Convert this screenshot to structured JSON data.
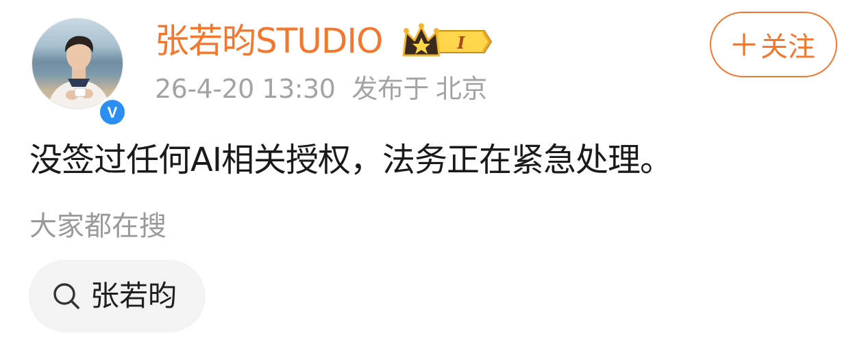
{
  "account": {
    "name": "张若昀STUDIO",
    "verified_badge_letter": "V",
    "member_badge_icon": "crown-icon",
    "member_level": "I",
    "avatar_icon": "avatar-photo"
  },
  "meta": {
    "date": "26-4-20 13:30",
    "posted_from_label": "发布于",
    "location": "北京"
  },
  "follow": {
    "label": "关注",
    "icon": "plus-icon"
  },
  "post": {
    "text": "没签过任何AI相关授权，法务正在紧急处理。"
  },
  "related_search": {
    "heading": "大家都在搜",
    "chip_label": "张若昀",
    "chip_icon": "search-icon"
  },
  "colors": {
    "accent": "#f4772e",
    "verified_blue": "#2a8ff0",
    "meta_gray": "#a3a3a3",
    "text_dark": "#1a1a1a",
    "chip_bg": "#f3f3f3",
    "badge_gold": "#f2b632"
  }
}
